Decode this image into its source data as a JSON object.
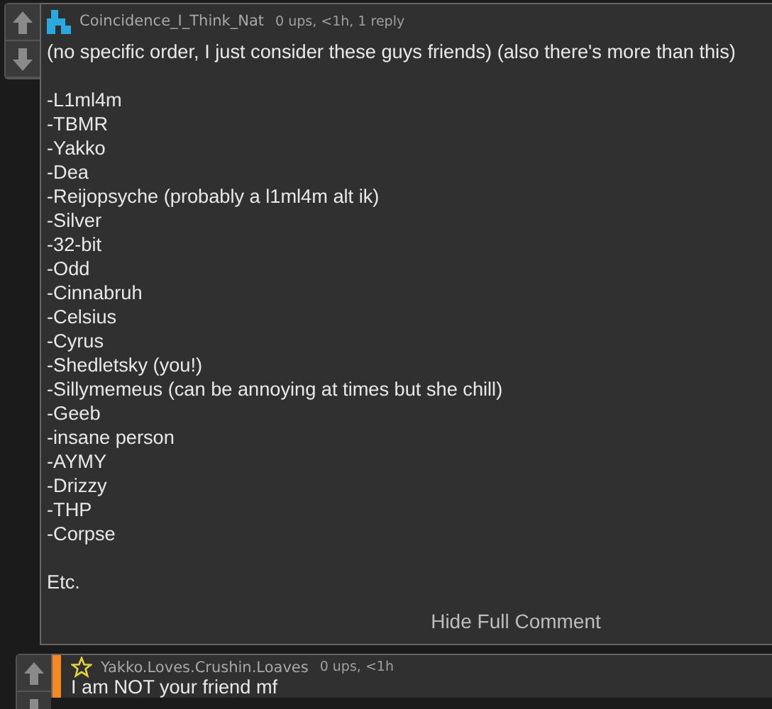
{
  "comments": [
    {
      "username": "Coincidence_I_Think_Nat",
      "meta": "0 ups, <1h, 1 reply",
      "kind": "pixel",
      "paragraphs": [
        "(no specific order, I just consider these guys friends) (also there's more than this)",
        "-L1ml4m\n-TBMR\n-Yakko\n-Dea\n-Reijopsyche (probably a l1ml4m alt ik)\n-Silver\n-32-bit\n-Odd\n-Cinnabruh\n-Celsius\n-Cyrus\n-Shedletsky (you!)\n-Sillymemeus (can be annoying at times but she chill)\n-Geeb\n-insane person\n-AYMY\n-Drizzy\n-THP\n-Corpse",
        "Etc."
      ],
      "toggle": "Hide Full Comment",
      "reply": false
    },
    {
      "username": "Yakko.Loves.Crushin.Loaves",
      "meta": "0 ups, <1h",
      "kind": "star",
      "paragraphs": [
        "I am NOT your friend mf"
      ],
      "reply": true
    }
  ]
}
